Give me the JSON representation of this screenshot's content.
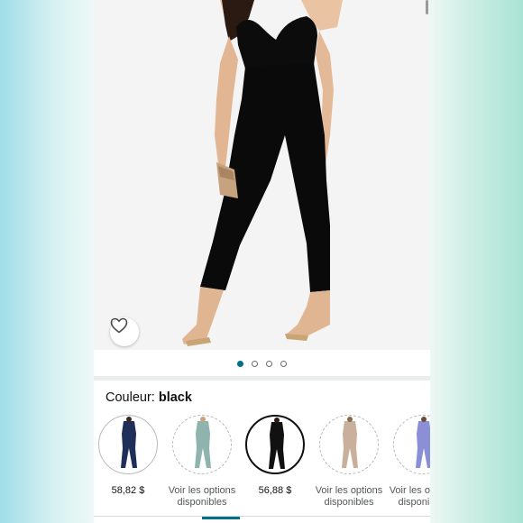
{
  "product_gallery": {
    "image_count": 4,
    "active_index": 0,
    "wishlist_icon": "heart-outline-icon"
  },
  "variation": {
    "label": "Couleur: ",
    "selected_value": "black"
  },
  "swatches": [
    {
      "color": "#1f2f5a",
      "price": "58,82 $",
      "options_text": ""
    },
    {
      "color": "#8fb3ad",
      "price": "",
      "options_text": "Voir les options disponibles"
    },
    {
      "color": "#111111",
      "price": "56,88 $",
      "options_text": ""
    },
    {
      "color": "#c9b09c",
      "price": "",
      "options_text": "Voir les options disponibles"
    },
    {
      "color": "#8a8fd6",
      "price": "",
      "options_text": "Voir les options disponibles"
    }
  ],
  "colors": {
    "accent": "#007185",
    "text": "#0f1111",
    "muted": "#565959"
  }
}
